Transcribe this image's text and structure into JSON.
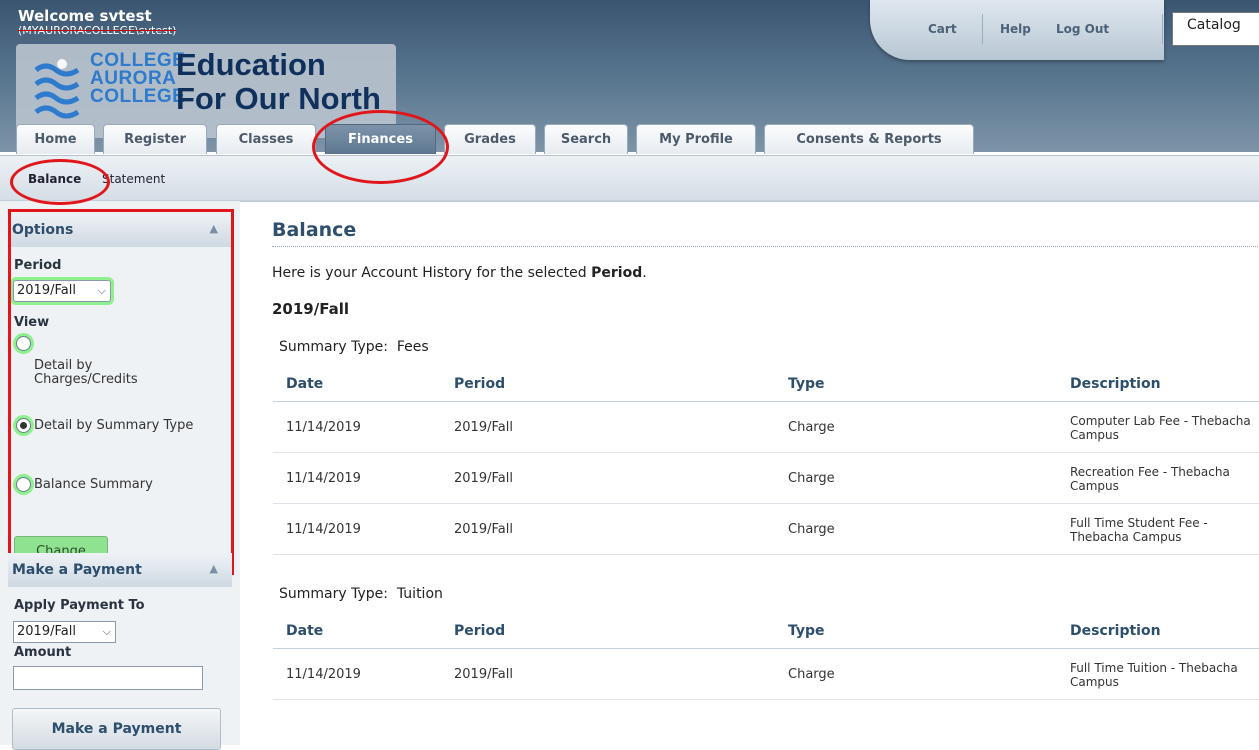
{
  "header": {
    "welcome": "Welcome svtest",
    "domain_user": "(MYAURORACOLLEGE\\svtest)",
    "logo": {
      "college_lines": [
        "COLLEGE",
        "AURORA",
        "COLLEGE"
      ],
      "tagline_lines": [
        "Education",
        "For Our North"
      ]
    },
    "links": {
      "cart": "Cart",
      "help": "Help",
      "logout": "Log Out"
    },
    "catalog": "Catalog"
  },
  "tabs": [
    {
      "label": "Home",
      "active": false
    },
    {
      "label": "Register",
      "active": false
    },
    {
      "label": "Classes",
      "active": false
    },
    {
      "label": "Finances",
      "active": true
    },
    {
      "label": "Grades",
      "active": false
    },
    {
      "label": "Search",
      "active": false
    },
    {
      "label": "My Profile",
      "active": false
    },
    {
      "label": "Consents & Reports",
      "active": false
    }
  ],
  "subnav": {
    "balance": "Balance",
    "statement": "Statement"
  },
  "options": {
    "title": "Options",
    "period_label": "Period",
    "period_value": "2019/Fall",
    "view_label": "View",
    "view_options": [
      "Detail by Charges/Credits",
      "Detail by Summary Type",
      "Balance Summary"
    ],
    "selected_view": "Detail by Summary Type",
    "change_button": "Change"
  },
  "payment": {
    "title": "Make a Payment",
    "apply_label": "Apply Payment To",
    "apply_value": "2019/Fall",
    "amount_label": "Amount",
    "amount_value": "",
    "button": "Make a Payment"
  },
  "main": {
    "title": "Balance",
    "intro_prefix": "Here is your Account History for the selected ",
    "intro_bold": "Period",
    "intro_suffix": ".",
    "period_heading": "2019/Fall",
    "columns": [
      "Date",
      "Period",
      "Type",
      "Description"
    ],
    "sections": [
      {
        "summary_label": "Summary Type:  Fees",
        "rows": [
          {
            "date": "11/14/2019",
            "period": "2019/Fall",
            "type": "Charge",
            "description": "Computer Lab Fee - Thebacha Campus"
          },
          {
            "date": "11/14/2019",
            "period": "2019/Fall",
            "type": "Charge",
            "description": "Recreation Fee - Thebacha Campus"
          },
          {
            "date": "11/14/2019",
            "period": "2019/Fall",
            "type": "Charge",
            "description": "Full Time Student Fee - Thebacha Campus"
          }
        ]
      },
      {
        "summary_label": "Summary Type:  Tuition",
        "rows": [
          {
            "date": "11/14/2019",
            "period": "2019/Fall",
            "type": "Charge",
            "description": "Full Time Tuition - Thebacha Campus"
          }
        ]
      }
    ]
  },
  "colors": {
    "header_dark": "#3a5570",
    "title_blue": "#2d4e6d",
    "annotation_red": "#e0161b",
    "highlight_green": "#8ef08e"
  }
}
